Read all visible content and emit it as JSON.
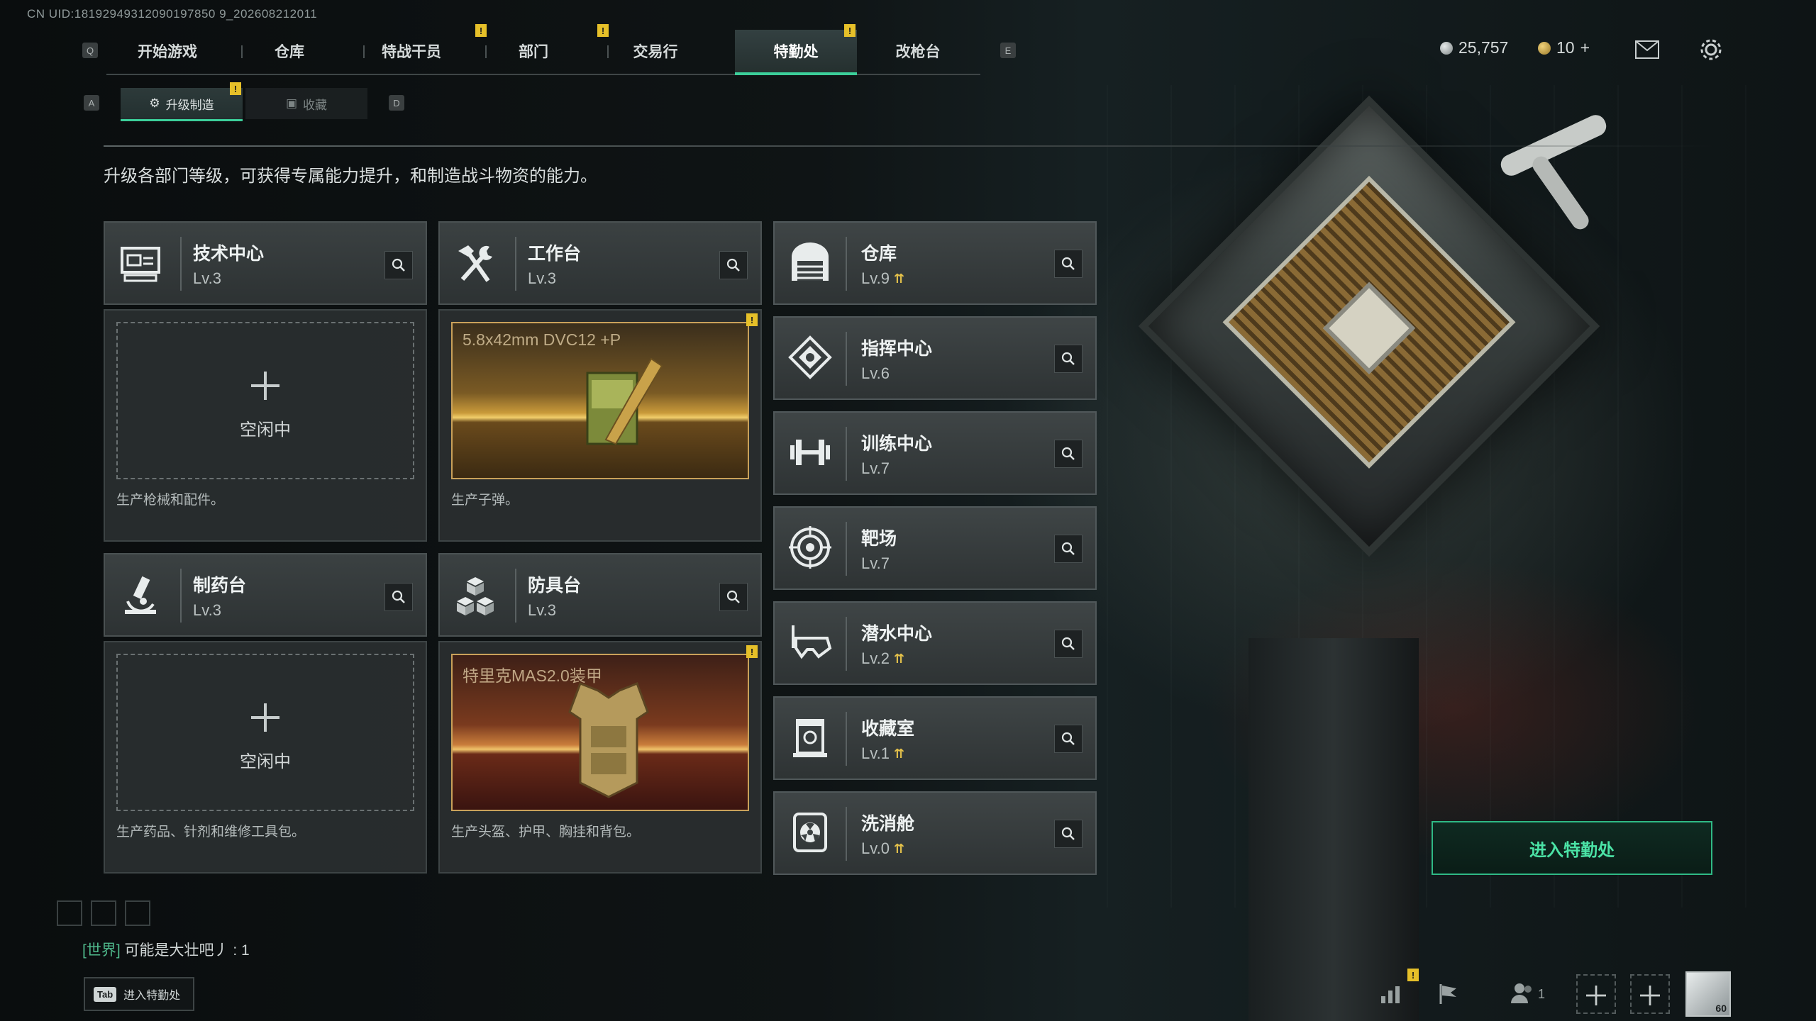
{
  "uid_text": "CN UID:18192949312090197850 9_202608212011",
  "nav": {
    "left_key": "Q",
    "right_key": "E",
    "tabs": [
      {
        "label": "开始游戏",
        "badge": ""
      },
      {
        "label": "仓库",
        "badge": ""
      },
      {
        "label": "特战干员",
        "badge": "!"
      },
      {
        "label": "部门",
        "badge": "!"
      },
      {
        "label": "交易行",
        "badge": ""
      },
      {
        "label": "特勤处",
        "badge": "!",
        "active": true
      },
      {
        "label": "改枪台",
        "badge": ""
      }
    ]
  },
  "currency": {
    "coins": "25,757",
    "tickets": "10",
    "add": "+"
  },
  "subnav": {
    "left_key": "A",
    "right_key": "D",
    "tabs": [
      {
        "label": "升级制造",
        "active": true,
        "badge": "!"
      },
      {
        "label": "收藏",
        "active": false
      }
    ]
  },
  "description": "升级各部门等级，可获得专属能力提升，和制造战斗物资的能力。",
  "production_stations": [
    {
      "name": "技术中心",
      "level": "Lv.3",
      "icon": "computer-icon",
      "status": "idle",
      "idle_label": "空闲中",
      "desc": "生产枪械和配件。"
    },
    {
      "name": "工作台",
      "level": "Lv.3",
      "icon": "tools-icon",
      "status": "producing",
      "product": "5.8x42mm DVC12 +P",
      "desc": "生产子弹。",
      "badge": "!"
    },
    {
      "name": "制药台",
      "level": "Lv.3",
      "icon": "microscope-icon",
      "status": "idle",
      "idle_label": "空闲中",
      "desc": "生产药品、针剂和维修工具包。"
    },
    {
      "name": "防具台",
      "level": "Lv.3",
      "icon": "cubes-icon",
      "status": "producing",
      "product": "特里克MAS2.0装甲",
      "desc": "生产头盔、护甲、胸挂和背包。",
      "badge": "!"
    }
  ],
  "departments": [
    {
      "name": "仓库",
      "level": "Lv.9",
      "upgradable": true,
      "icon": "warehouse-icon"
    },
    {
      "name": "指挥中心",
      "level": "Lv.6",
      "upgradable": false,
      "icon": "command-icon"
    },
    {
      "name": "训练中心",
      "level": "Lv.7",
      "upgradable": false,
      "icon": "dumbbell-icon"
    },
    {
      "name": "靶场",
      "level": "Lv.7",
      "upgradable": false,
      "icon": "target-icon"
    },
    {
      "name": "潜水中心",
      "level": "Lv.2",
      "upgradable": true,
      "icon": "diving-mask-icon"
    },
    {
      "name": "收藏室",
      "level": "Lv.1",
      "upgradable": true,
      "icon": "collection-icon"
    },
    {
      "name": "洗消舱",
      "level": "Lv.0",
      "upgradable": true,
      "icon": "radiation-icon"
    }
  ],
  "enter_button": "进入特勤处",
  "chat": {
    "channel": "[世界]",
    "message": "可能是大壮吧丿 : 1"
  },
  "tab_hint": {
    "key": "Tab",
    "label": "进入特勤处"
  },
  "bottom_bar": {
    "friend_count": "1",
    "avatar_level": "60"
  },
  "colors": {
    "accent": "#3ccf9a",
    "badge": "#e6c029",
    "upgrade_arrow": "#e3c04a"
  }
}
